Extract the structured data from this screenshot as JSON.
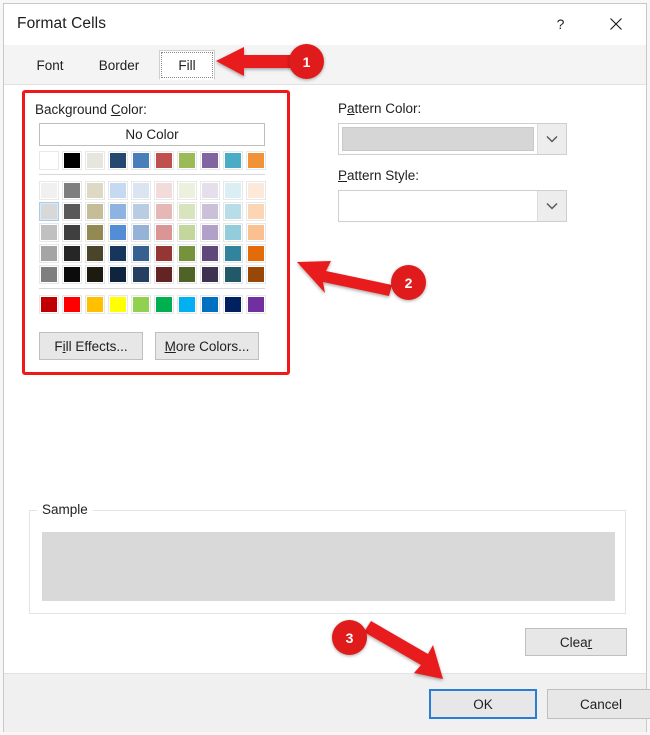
{
  "window": {
    "title": "Format Cells",
    "help_icon": "question-mark-icon",
    "close_icon": "close-icon"
  },
  "tabs": [
    {
      "label": "Font",
      "selected": false
    },
    {
      "label": "Border",
      "selected": false
    },
    {
      "label": "Fill",
      "selected": true
    }
  ],
  "background_color": {
    "label_prefix": "Background ",
    "label_accel": "C",
    "label_suffix": "olor:",
    "no_color_label": "No Color",
    "fill_effects": {
      "prefix": "F",
      "accel": "i",
      "suffix": "ll Effects..."
    },
    "more_colors": {
      "prefix": "",
      "accel": "M",
      "suffix": "ore Colors..."
    }
  },
  "pattern_color": {
    "label_prefix": "P",
    "label_accel": "a",
    "label_suffix": "ttern Color:",
    "selected_swatch": "#d6d6d6",
    "dropdown_icon": "chevron-down-icon"
  },
  "pattern_style": {
    "label_prefix": "",
    "label_accel": "P",
    "label_suffix": "attern Style:",
    "value": "",
    "dropdown_icon": "chevron-down-icon"
  },
  "sample": {
    "legend": "Sample",
    "preview_color": "#d9d9d9"
  },
  "buttons": {
    "clear": {
      "prefix": "Clea",
      "accel": "r",
      "suffix": ""
    },
    "ok": "OK",
    "cancel": "Cancel"
  },
  "annotations": [
    {
      "number": "1",
      "target": "fill-tab"
    },
    {
      "number": "2",
      "target": "background-color-palette"
    },
    {
      "number": "3",
      "target": "ok-button"
    }
  ],
  "colors": {
    "accent": "#2b7cd3",
    "annotation_red": "#e01b1b",
    "dialog_bg": "#ffffff",
    "footer_bg": "#f0f0f0"
  },
  "palette": {
    "theme_row": [
      "#ffffff",
      "#000000",
      "#e7e6de",
      "#24486f",
      "#4a7ebb",
      "#c0504d",
      "#9bbb59",
      "#8165a0",
      "#4bacc6",
      "#f19138"
    ],
    "tint_rows": [
      [
        "#f0f0f0",
        "#7e7e7e",
        "#ddd9c4",
        "#c5d9f1",
        "#dbe5f1",
        "#f2dcdb",
        "#ebf1dd",
        "#e5dfec",
        "#dbeef3",
        "#fde9d9"
      ],
      [
        "#d8d8d8",
        "#595959",
        "#c4bd97",
        "#8db3e2",
        "#b8cce4",
        "#e5b8b7",
        "#d7e4bd",
        "#ccc0d9",
        "#b7dde8",
        "#fcd5b4"
      ],
      [
        "#c0c0c0",
        "#3f3f3f",
        "#938953",
        "#538dd5",
        "#95b3d7",
        "#da9694",
        "#c3d69b",
        "#b1a0c7",
        "#92cddc",
        "#fac08f"
      ],
      [
        "#a5a5a5",
        "#262626",
        "#4a452a",
        "#17365d",
        "#36608f",
        "#963634",
        "#76923c",
        "#60497a",
        "#31849b",
        "#e36c09"
      ],
      [
        "#7f7f7f",
        "#0c0c0c",
        "#1d1b10",
        "#0f243e",
        "#243f60",
        "#632423",
        "#4f6228",
        "#3f3151",
        "#215968",
        "#974806"
      ]
    ],
    "standard_row": [
      "#c00000",
      "#ff0000",
      "#ffc000",
      "#ffff00",
      "#92d050",
      "#00b050",
      "#00b0f0",
      "#0070c0",
      "#002060",
      "#7030a0"
    ],
    "hovered_index": {
      "row": 1,
      "col": 0
    }
  }
}
